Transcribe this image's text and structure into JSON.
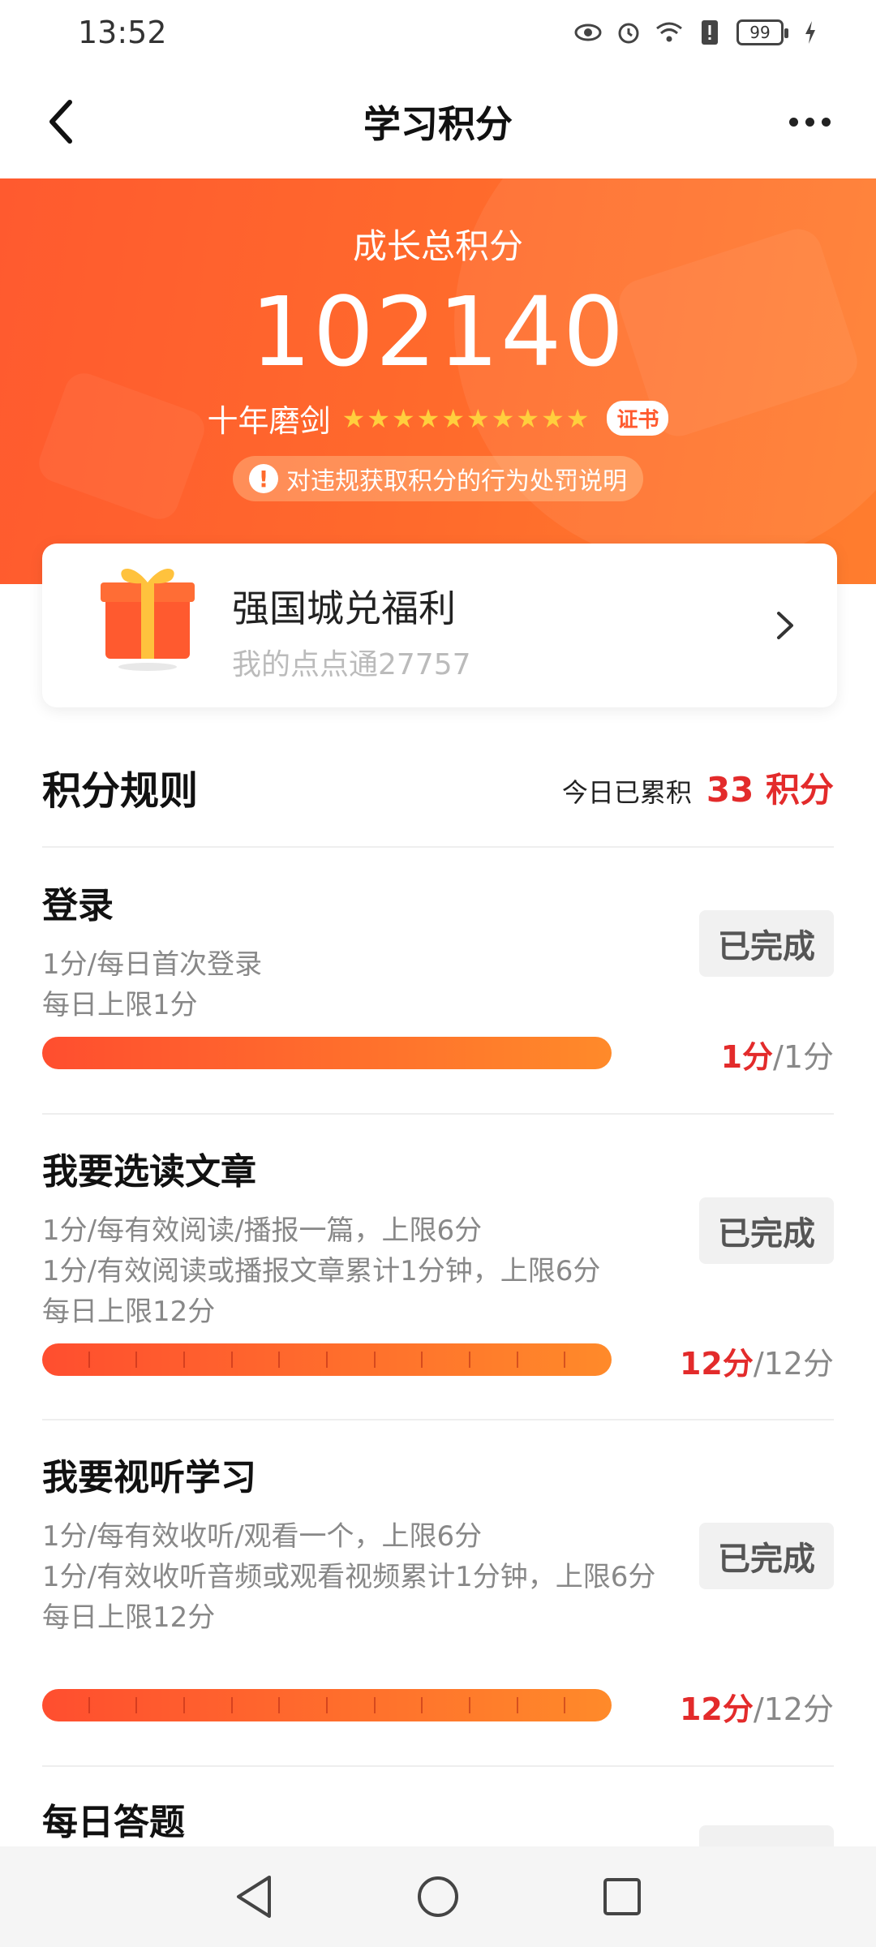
{
  "statusbar": {
    "time": "13:52",
    "battery": "99"
  },
  "header": {
    "title": "学习积分"
  },
  "hero": {
    "subtitle": "成长总积分",
    "score": "102140",
    "rank": "十年磨剑",
    "stars": 10,
    "cert_label": "证书",
    "notice": "对违规获取积分的行为处罚说明"
  },
  "welfare": {
    "title": "强国城兑福利",
    "points": "我的点点通27757"
  },
  "rules": {
    "title": "积分规则",
    "today_label": "今日已累积",
    "today_value": "33 积分",
    "tasks": [
      {
        "name": "登录",
        "desc": [
          "1分/每日首次登录",
          "每日上限1分"
        ],
        "button": "已完成",
        "got": "1分",
        "total": "/1分",
        "progress": 1.0
      },
      {
        "name": "我要选读文章",
        "desc": [
          "1分/每有效阅读/播报一篇，上限6分",
          "1分/有效阅读或播报文章累计1分钟，上限6分",
          "每日上限12分"
        ],
        "button": "已完成",
        "got": "12分",
        "total": "/12分",
        "progress": 1.0
      },
      {
        "name": "我要视听学习",
        "desc": [
          "1分/每有效收听/观看一个，上限6分",
          "1分/有效收听音频或观看视频累计1分钟，上限6分",
          "每日上限12分"
        ],
        "button": "已完成",
        "got": "12分",
        "total": "/12分",
        "progress": 1.0
      },
      {
        "name": "每日答题"
      }
    ]
  }
}
